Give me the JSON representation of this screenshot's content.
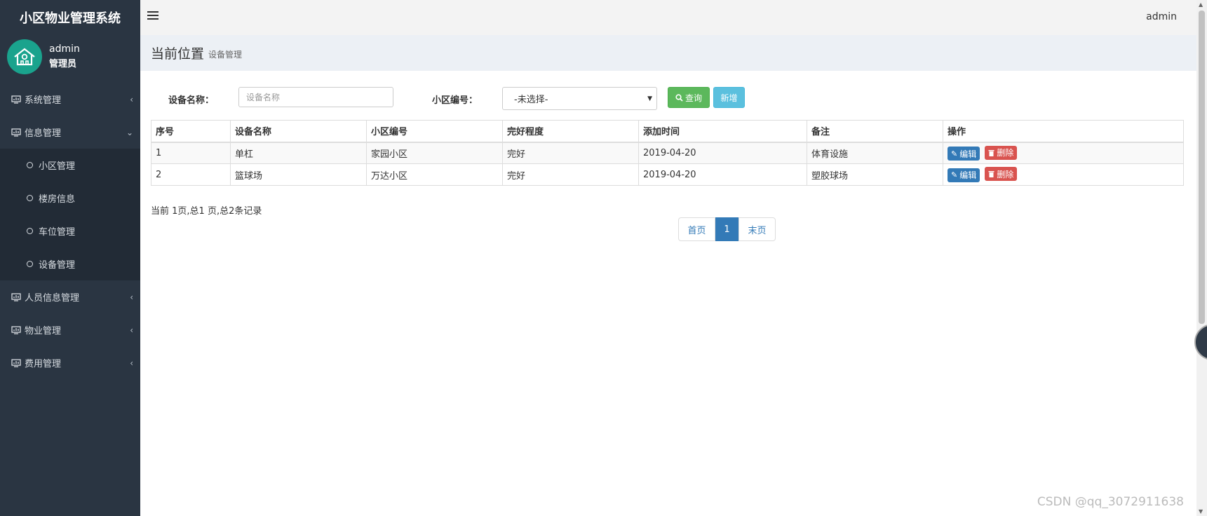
{
  "app": {
    "title": "小区物业管理系统"
  },
  "user": {
    "name": "admin",
    "role": "管理员"
  },
  "sidebar": {
    "items": [
      {
        "label": "系统管理",
        "icon": "monitor-icon",
        "expanded": false
      },
      {
        "label": "信息管理",
        "icon": "monitor-icon",
        "expanded": true,
        "children": [
          "小区管理",
          "楼房信息",
          "车位管理",
          "设备管理"
        ]
      },
      {
        "label": "人员信息管理",
        "icon": "monitor-icon",
        "expanded": false
      },
      {
        "label": "物业管理",
        "icon": "monitor-icon",
        "expanded": false
      },
      {
        "label": "费用管理",
        "icon": "monitor-icon",
        "expanded": false
      }
    ]
  },
  "topbar": {
    "user": "admin"
  },
  "breadcrumb": {
    "title": "当前位置",
    "current": "设备管理"
  },
  "search": {
    "name_label": "设备名称：",
    "name_placeholder": "设备名称",
    "community_label": "小区编号：",
    "community_selected": "-未选择-",
    "query_label": "查询",
    "add_label": "新增"
  },
  "table": {
    "headers": [
      "序号",
      "设备名称",
      "小区编号",
      "完好程度",
      "添加时间",
      "备注",
      "操作"
    ],
    "rows": [
      [
        "1",
        "单杠",
        "家园小区",
        "完好",
        "2019-04-20",
        "体育设施"
      ],
      [
        "2",
        "篮球场",
        "万达小区",
        "完好",
        "2019-04-20",
        "塑胶球场"
      ]
    ],
    "edit_label": "编辑",
    "delete_label": "删除"
  },
  "pagination": {
    "summary": "当前 1页,总1 页,总2条记录",
    "first": "首页",
    "current": "1",
    "last": "末页"
  },
  "watermark": "CSDN @qq_3072911638",
  "colors": {
    "sidebar_bg": "#2a3542",
    "avatar_bg": "#1aa38d",
    "primary": "#337ab7",
    "success": "#5cb85c",
    "info": "#5bc0de",
    "danger": "#d9534f"
  }
}
